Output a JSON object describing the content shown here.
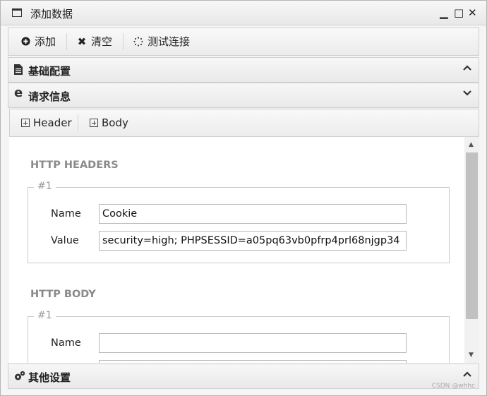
{
  "window": {
    "title": "添加数据",
    "controls": {
      "minimize": "▁",
      "maximize": "□",
      "close": "✕"
    }
  },
  "toolbar": {
    "add_label": "添加",
    "clear_label": "清空",
    "test_label": "测试连接",
    "add_icon": "plus-circle-icon",
    "clear_icon": "x-icon",
    "test_icon": "spinner-icon"
  },
  "panels": {
    "basic": {
      "title": "基础配置",
      "icon": "file-icon"
    },
    "request": {
      "title": "请求信息",
      "icon": "edge-browser-icon"
    },
    "other": {
      "title": "其他设置",
      "icon": "gears-icon"
    }
  },
  "tabs": [
    {
      "label": "Header"
    },
    {
      "label": "Body"
    }
  ],
  "headers_section": {
    "title": "HTTP HEADERS",
    "items": [
      {
        "legend": "#1",
        "name_label": "Name",
        "value_label": "Value",
        "name": "Cookie",
        "value": "security=high; PHPSESSID=a05pq63vb0pfrp4prl68njgp34"
      }
    ]
  },
  "body_section": {
    "title": "HTTP BODY",
    "items": [
      {
        "legend": "#1",
        "name_label": "Name",
        "name": "",
        "value": ""
      }
    ]
  },
  "watermark": "CSDN @whhc",
  "colors": {
    "section_title": "#8a8a8a",
    "scroll_thumb": "#c1c1c1"
  }
}
